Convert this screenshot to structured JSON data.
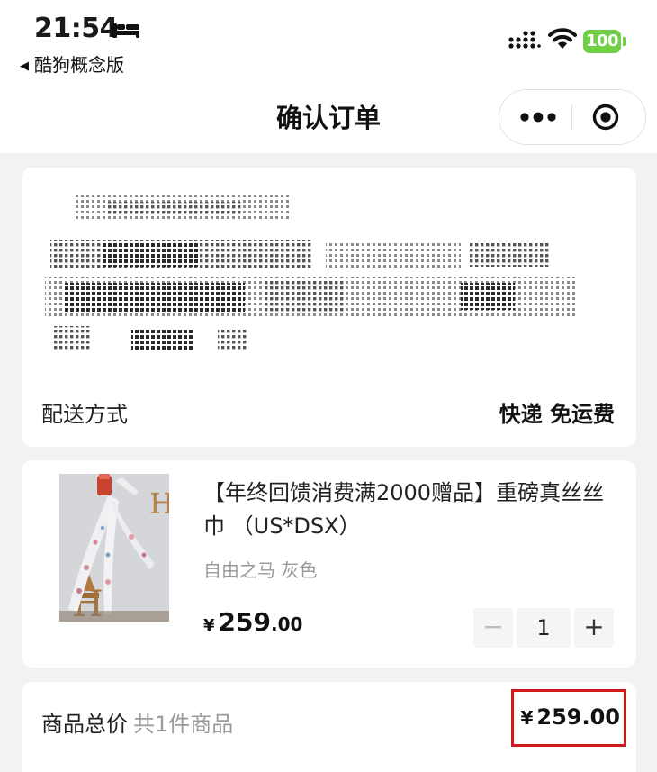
{
  "status_bar": {
    "time": "21:54",
    "back_app_label": "酷狗概念版",
    "battery_level": "100",
    "battery_color": "#6fcf47"
  },
  "nav": {
    "title": "确认订单",
    "icons": [
      "more-icon",
      "target-icon"
    ]
  },
  "address": {
    "delivery_label": "配送方式",
    "delivery_value": "快递 免运费"
  },
  "product": {
    "title": "【年终回馈消费满2000赠品】重磅真丝丝巾 （US*DSX）",
    "spec": "自由之马 灰色",
    "price_symbol": "¥",
    "price_integer": "259",
    "price_decimal": ".00",
    "quantity": "1",
    "minus_label": "−",
    "plus_label": "+"
  },
  "summary": {
    "total_label": "商品总价",
    "item_count": "共1件商品",
    "price_symbol": "¥",
    "total_price": "259.00",
    "highlight_color": "#d0191b"
  }
}
